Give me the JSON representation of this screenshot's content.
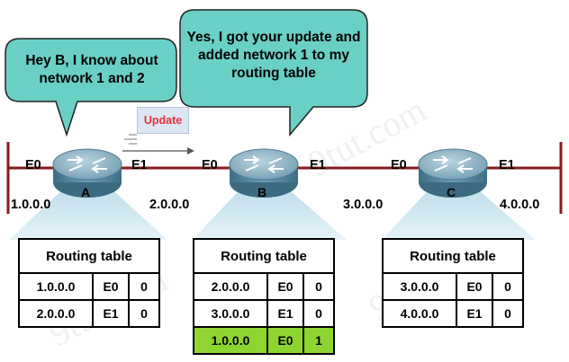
{
  "bubbles": {
    "a_text": "Hey B, I know about network 1 and 2",
    "b_text": "Yes, I got your update and added network 1 to my routing table"
  },
  "update_label": "Update",
  "routers": [
    {
      "name": "A",
      "left_if": "E0",
      "right_if": "E1"
    },
    {
      "name": "B",
      "left_if": "E0",
      "right_if": "E1"
    },
    {
      "name": "C",
      "left_if": "E0",
      "right_if": "E1"
    }
  ],
  "networks": [
    "1.0.0.0",
    "2.0.0.0",
    "3.0.0.0",
    "4.0.0.0"
  ],
  "tables": [
    {
      "title": "Routing table",
      "rows": [
        {
          "net": "1.0.0.0",
          "iface": "E0",
          "hops": "0"
        },
        {
          "net": "2.0.0.0",
          "iface": "E1",
          "hops": "0"
        }
      ]
    },
    {
      "title": "Routing table",
      "rows": [
        {
          "net": "2.0.0.0",
          "iface": "E0",
          "hops": "0"
        },
        {
          "net": "3.0.0.0",
          "iface": "E1",
          "hops": "0"
        },
        {
          "net": "1.0.0.0",
          "iface": "E0",
          "hops": "1",
          "highlight": true
        }
      ]
    },
    {
      "title": "Routing table",
      "rows": [
        {
          "net": "3.0.0.0",
          "iface": "E0",
          "hops": "0"
        },
        {
          "net": "4.0.0.0",
          "iface": "E1",
          "hops": "0"
        }
      ]
    }
  ],
  "colors": {
    "link": "#8b1a1a",
    "bubble": "#6ad0c6",
    "bubble_border": "#222222",
    "router_body": "#4f8199",
    "router_top": "#8fb5c7",
    "cone": "#c9e4f0",
    "highlight_row": "#8fd531",
    "update_text": "#e8323c"
  },
  "watermark": "9tut.com"
}
